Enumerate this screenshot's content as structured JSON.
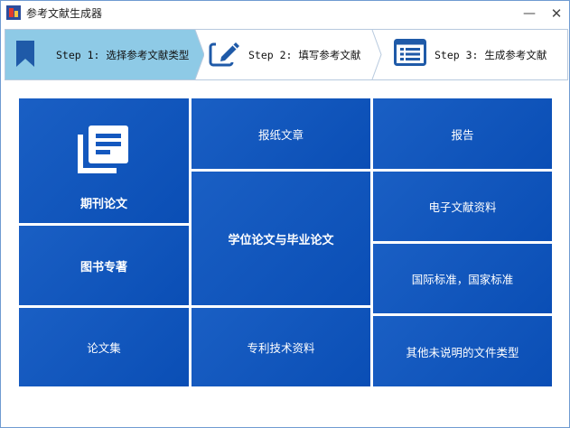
{
  "window": {
    "title": "参考文献生成器",
    "minimize_glyph": "—",
    "close_glyph": "✕"
  },
  "steps": [
    {
      "label": "Step 1: 选择参考文献类型",
      "icon": "bookmark-icon",
      "active": true
    },
    {
      "label": "Step 2: 填写参考文献",
      "icon": "edit-icon",
      "active": false
    },
    {
      "label": "Step 3: 生成参考文献",
      "icon": "list-icon",
      "active": false
    }
  ],
  "tiles": {
    "journal": "期刊论文",
    "newspaper": "报纸文章",
    "report": "报告",
    "thesis": "学位论文与毕业论文",
    "electronic": "电子文献资料",
    "books": "图书专著",
    "standard": "国际标准，国家标准",
    "proceedings": "论文集",
    "patent": "专利技术资料",
    "other": "其他未说明的文件类型"
  },
  "colors": {
    "tile_blue": "#0d52b8",
    "active_step": "#8ecae6",
    "icon_blue": "#1f5aa8"
  }
}
